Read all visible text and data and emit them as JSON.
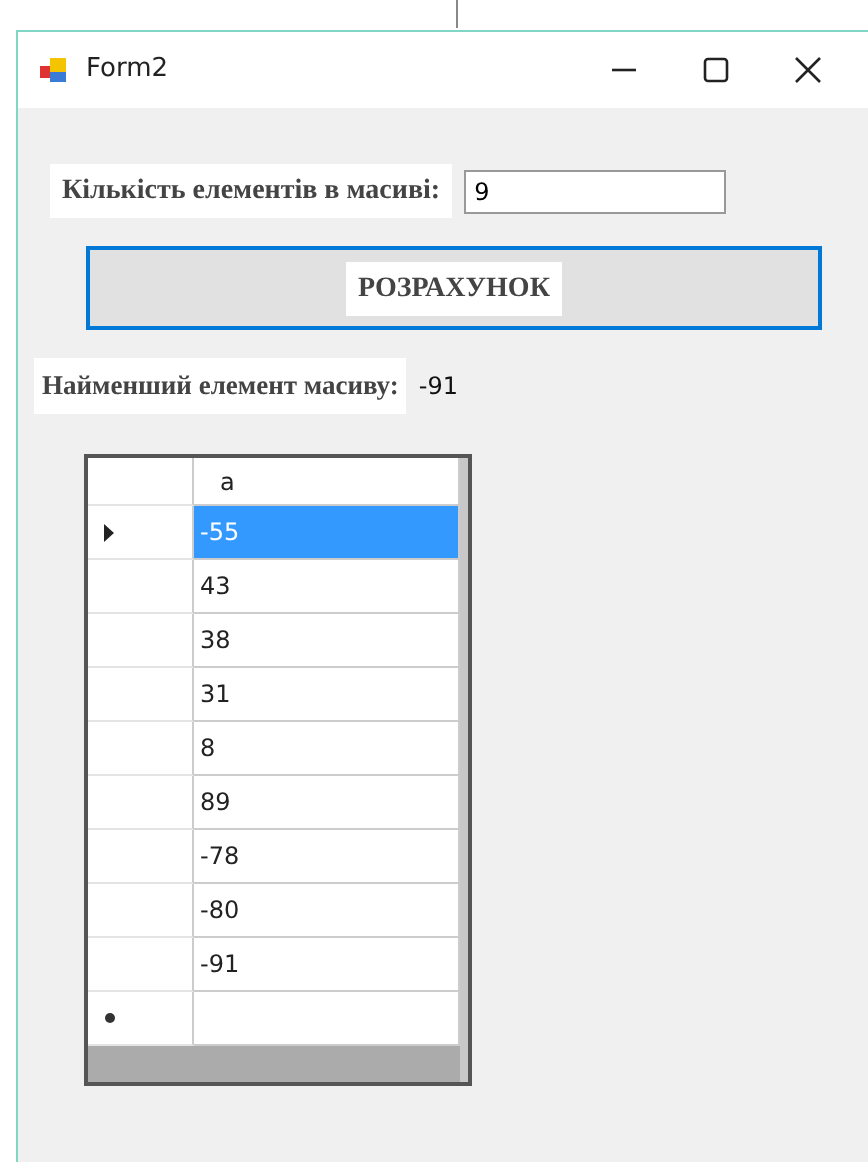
{
  "window": {
    "title": "Form2"
  },
  "count_label": "Кількість елементів в масиві:",
  "count_field": {
    "value": "9"
  },
  "calculate_button": {
    "label": "РОЗРАХУНОК",
    "focused": true
  },
  "result_label": "Найменший елемент масиву:",
  "result_value": "-91",
  "grid": {
    "columns": [
      "a"
    ],
    "rows": [
      {
        "value": "-55",
        "selected": true
      },
      {
        "value": "43",
        "selected": false
      },
      {
        "value": "38",
        "selected": false
      },
      {
        "value": "31",
        "selected": false
      },
      {
        "value": "8",
        "selected": false
      },
      {
        "value": "89",
        "selected": false
      },
      {
        "value": "-78",
        "selected": false
      },
      {
        "value": "-80",
        "selected": false
      },
      {
        "value": "-91",
        "selected": false
      }
    ],
    "new_row": true
  }
}
